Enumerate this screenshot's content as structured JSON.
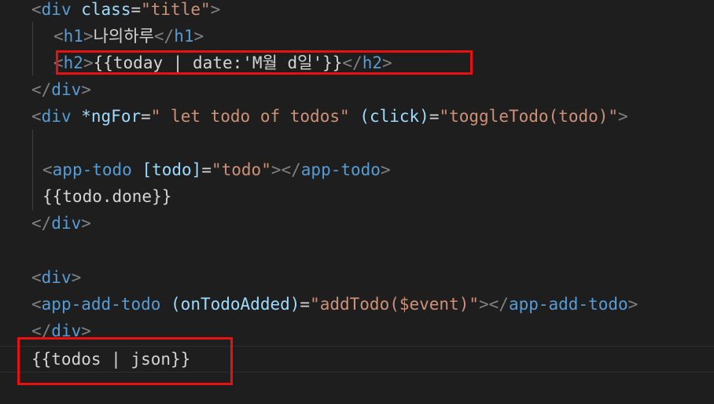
{
  "code_lines": [
    {
      "tokens": [
        {
          "c": "tb",
          "t": "<"
        },
        {
          "c": "tg",
          "t": "div"
        },
        {
          "c": "tx",
          "t": " "
        },
        {
          "c": "at",
          "t": "class"
        },
        {
          "c": "tx",
          "t": "="
        },
        {
          "c": "st",
          "t": "\"title\""
        },
        {
          "c": "tb",
          "t": ">"
        }
      ]
    },
    {
      "tokens": [
        {
          "c": "tb",
          "t": "<"
        },
        {
          "c": "tg",
          "t": "h1"
        },
        {
          "c": "tb",
          "t": ">"
        },
        {
          "c": "tx",
          "t": "나의하루"
        },
        {
          "c": "tb",
          "t": "</"
        },
        {
          "c": "tg",
          "t": "h1"
        },
        {
          "c": "tb",
          "t": ">"
        }
      ]
    },
    {
      "tokens": [
        {
          "c": "tb",
          "t": "<"
        },
        {
          "c": "tg",
          "t": "h2"
        },
        {
          "c": "tb",
          "t": ">"
        },
        {
          "c": "tx",
          "t": "{{today | date:'M월 d일'}}"
        },
        {
          "c": "tb",
          "t": "</"
        },
        {
          "c": "tg",
          "t": "h2"
        },
        {
          "c": "tb",
          "t": ">"
        }
      ]
    },
    {
      "tokens": [
        {
          "c": "tb",
          "t": "</"
        },
        {
          "c": "tg",
          "t": "div"
        },
        {
          "c": "tb",
          "t": ">"
        }
      ]
    },
    {
      "tokens": [
        {
          "c": "tb",
          "t": "<"
        },
        {
          "c": "tg",
          "t": "div"
        },
        {
          "c": "tx",
          "t": " "
        },
        {
          "c": "at",
          "t": "*ngFor"
        },
        {
          "c": "tx",
          "t": "="
        },
        {
          "c": "st",
          "t": "\" let todo of todos\""
        },
        {
          "c": "tx",
          "t": " "
        },
        {
          "c": "at",
          "t": "(click)"
        },
        {
          "c": "tx",
          "t": "="
        },
        {
          "c": "st",
          "t": "\"toggleTodo(todo)\""
        },
        {
          "c": "tb",
          "t": ">"
        }
      ]
    },
    {
      "tokens": []
    },
    {
      "tokens": [
        {
          "c": "tb",
          "t": "<"
        },
        {
          "c": "tg",
          "t": "app-todo"
        },
        {
          "c": "tx",
          "t": " "
        },
        {
          "c": "at",
          "t": "[todo]"
        },
        {
          "c": "tx",
          "t": "="
        },
        {
          "c": "st",
          "t": "\"todo\""
        },
        {
          "c": "tb",
          "t": "></"
        },
        {
          "c": "tg",
          "t": "app-todo"
        },
        {
          "c": "tb",
          "t": ">"
        }
      ]
    },
    {
      "tokens": [
        {
          "c": "tx",
          "t": "{{todo.done}}"
        }
      ]
    },
    {
      "tokens": [
        {
          "c": "tb",
          "t": "</"
        },
        {
          "c": "tg",
          "t": "div"
        },
        {
          "c": "tb",
          "t": ">"
        }
      ]
    },
    {
      "tokens": []
    },
    {
      "tokens": [
        {
          "c": "tb",
          "t": "<"
        },
        {
          "c": "tg",
          "t": "div"
        },
        {
          "c": "tb",
          "t": ">"
        }
      ]
    },
    {
      "tokens": [
        {
          "c": "tb",
          "t": "<"
        },
        {
          "c": "tg",
          "t": "app-add-todo"
        },
        {
          "c": "tx",
          "t": " "
        },
        {
          "c": "at",
          "t": "(onTodoAdded)"
        },
        {
          "c": "tx",
          "t": "="
        },
        {
          "c": "st",
          "t": "\"addTodo($event)\""
        },
        {
          "c": "tb",
          "t": "></"
        },
        {
          "c": "tg",
          "t": "app-add-todo"
        },
        {
          "c": "tb",
          "t": ">"
        }
      ]
    },
    {
      "tokens": [
        {
          "c": "tb",
          "t": "</"
        },
        {
          "c": "tg",
          "t": "div"
        },
        {
          "c": "tb",
          "t": ">"
        }
      ]
    },
    {
      "tokens": [
        {
          "c": "tx",
          "t": "{{todos | json}}"
        }
      ]
    }
  ],
  "colors": {
    "background": "#1e1e1e",
    "tag_bracket": "#808080",
    "tag_name": "#569cd6",
    "attribute": "#9cdcfe",
    "string": "#ce9178",
    "text": "#d4d4d4",
    "highlight_box": "#e81010"
  }
}
